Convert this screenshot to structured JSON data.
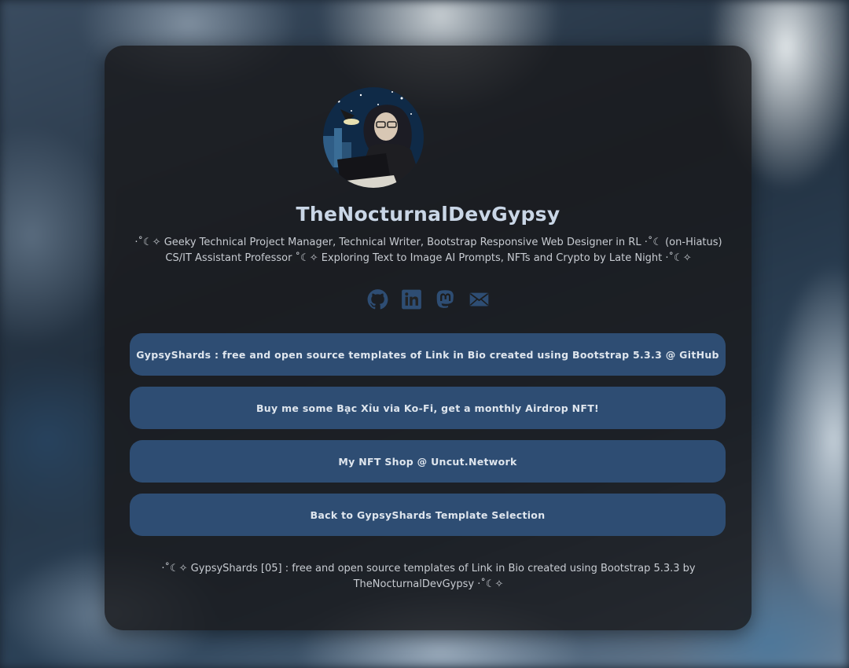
{
  "profile": {
    "name": "TheNocturnalDevGypsy",
    "bio": "‧˚☾✧ Geeky Technical Project Manager, Technical Writer, Bootstrap Responsive Web Designer in RL ‧˚☾ (on-Hiatus) CS/IT Assistant Professor ˚☾✧ Exploring Text to Image AI Prompts, NFTs and Crypto by Late Night ‧˚☾✧"
  },
  "socials": [
    {
      "icon": "github-icon"
    },
    {
      "icon": "linkedin-icon"
    },
    {
      "icon": "mastodon-icon"
    },
    {
      "icon": "email-icon"
    }
  ],
  "links": [
    {
      "label": "GypsyShards : free and open source templates of Link in Bio created using Bootstrap 5.3.3 @ GitHub"
    },
    {
      "label": "Buy me some Bạc Xỉu via Ko-Fi, get a monthly Airdrop NFT!"
    },
    {
      "label": "My NFT Shop @ Uncut.Network"
    },
    {
      "label": "Back to GypsyShards Template Selection"
    }
  ],
  "footer": {
    "text": "‧˚☾✧ GypsyShards [05] : free and open source templates of Link in Bio created using Bootstrap 5.3.3 by TheNocturnalDevGypsy ‧˚☾✧"
  },
  "colors": {
    "button_bg": "#2e4d73",
    "card_bg": "rgba(26,26,28,0.82)",
    "name_text": "#c9d6e6",
    "icon": "#2e4d73"
  }
}
